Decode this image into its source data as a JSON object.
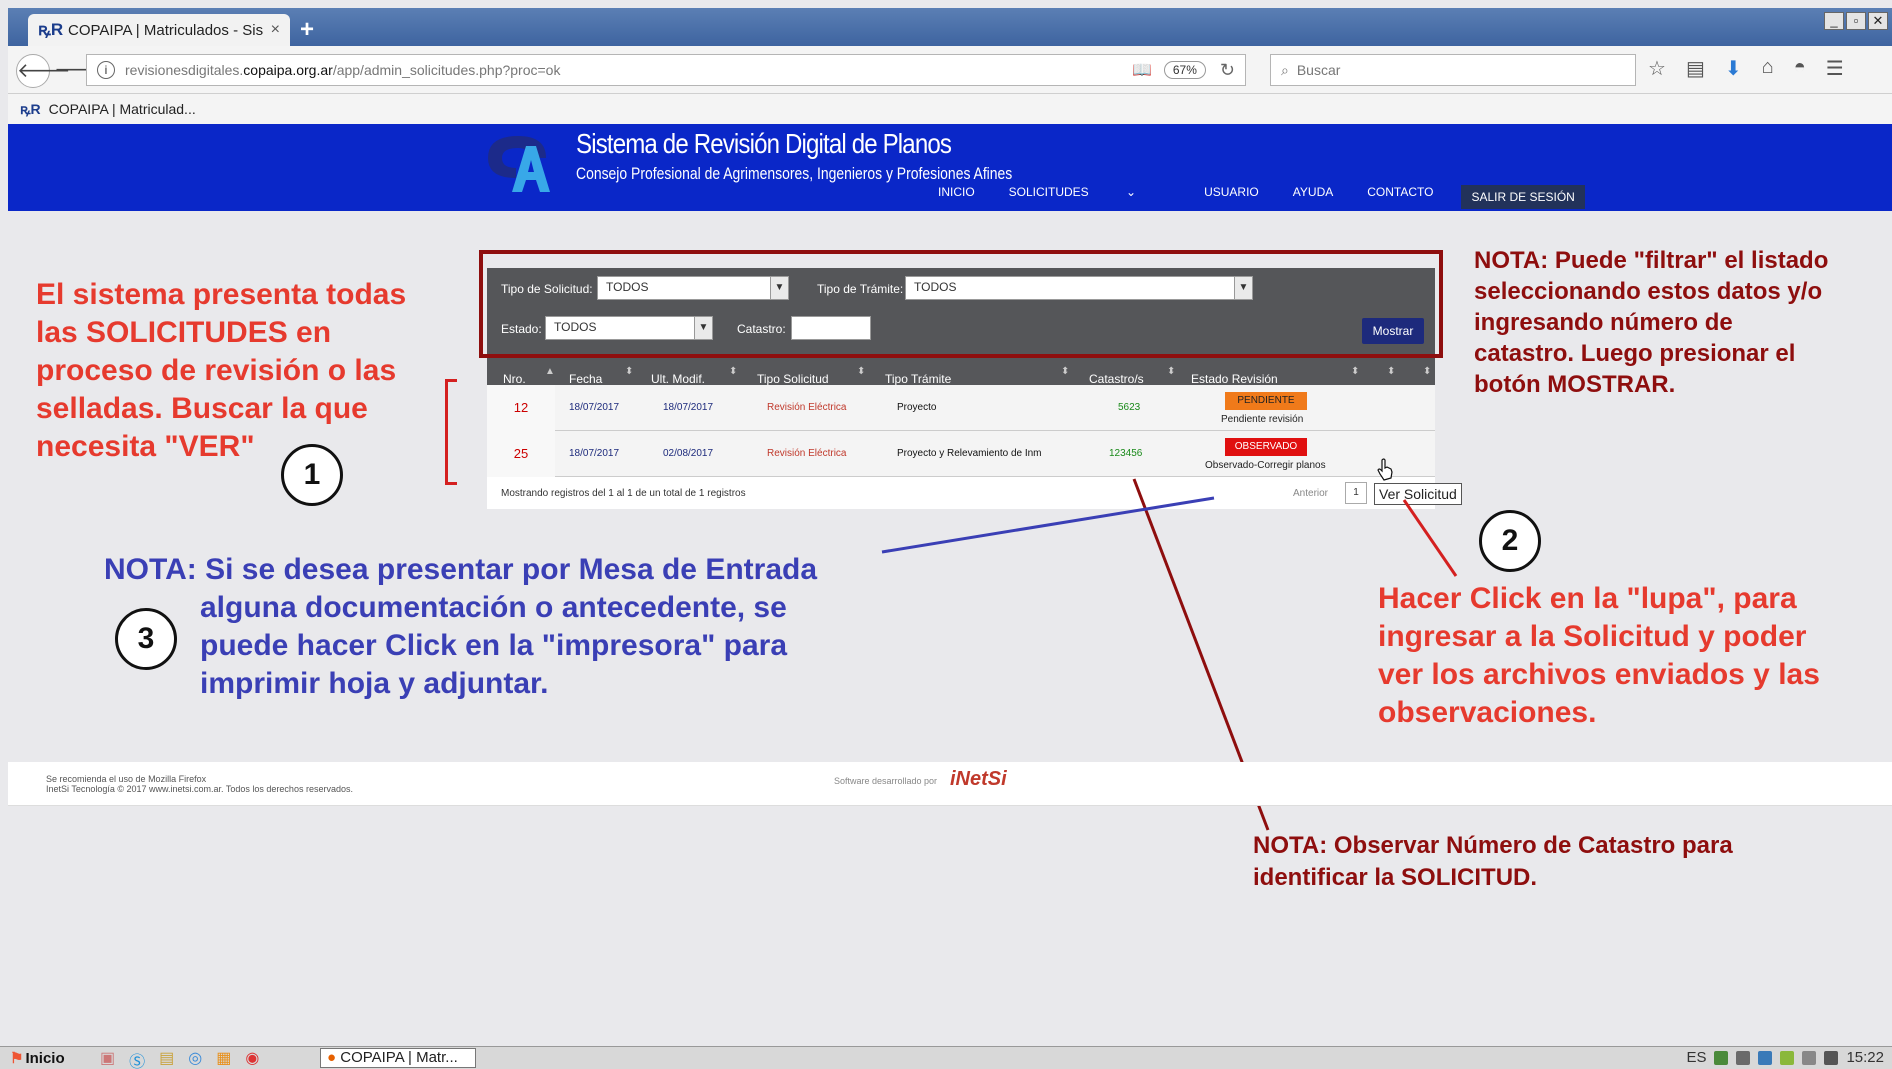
{
  "browser": {
    "tab_title": "COPAIPA | Matriculados - Sistem",
    "tab_close": "×",
    "new_tab": "+",
    "url_host_prefix": "revisionesdigitales.",
    "url_host": "copaipa.org.ar",
    "url_path": "/app/admin_solicitudes.php?proc=ok",
    "zoom": "67%",
    "search_placeholder": "Buscar",
    "bookmark": "COPAIPA | Matriculad..."
  },
  "header": {
    "title": "Sistema de Revisión Digital de Planos",
    "subtitle": "Consejo Profesional de Agrimensores, Ingenieros y Profesiones Afines",
    "menu": {
      "inicio": "INICIO",
      "solicitudes": "SOLICITUDES",
      "usuario": "USUARIO",
      "ayuda": "AYUDA",
      "contacto": "CONTACTO",
      "salir": "SALIR DE SESIÓN"
    }
  },
  "filters": {
    "tipo_solicitud_label": "Tipo de Solicitud:",
    "tipo_solicitud_value": "TODOS",
    "tipo_tramite_label": "Tipo de Trámite:",
    "tipo_tramite_value": "TODOS",
    "estado_label": "Estado:",
    "estado_value": "TODOS",
    "catastro_label": "Catastro:",
    "mostrar": "Mostrar"
  },
  "table": {
    "columns": {
      "nro": "Nro.",
      "fecha": "Fecha",
      "ult": "Ult. Modif.",
      "tsol": "Tipo Solicitud",
      "ttra": "Tipo Trámite",
      "cat": "Catastro/s",
      "estado": "Estado Revisión"
    },
    "rows": [
      {
        "nro": "12",
        "fecha": "18/07/2017",
        "modif": "18/07/2017",
        "tipo_solicitud": "Revisión Eléctrica",
        "tipo_tramite": "Proyecto",
        "catastro": "5623",
        "badge": "PENDIENTE",
        "estado": "Pendiente revisión"
      },
      {
        "nro": "25",
        "fecha": "18/07/2017",
        "modif": "02/08/2017",
        "tipo_solicitud": "Revisión Eléctrica",
        "tipo_tramite": "Proyecto y Relevamiento de Inm",
        "catastro": "123456",
        "badge": "OBSERVADO",
        "estado": "Observado-Corregir planos"
      }
    ],
    "footer_info": "Mostrando registros del 1 al 1 de un total de 1 registros",
    "prev": "Anterior",
    "page": "1",
    "tooltip": "Ver Solicitud"
  },
  "annotations": {
    "left": [
      "El sistema presenta todas",
      "las SOLICITUDES en",
      "proceso de revisión o las",
      "selladas. Buscar la que",
      "necesita \"VER\""
    ],
    "filter_note": [
      "NOTA: Puede \"filtrar\" el listado",
      "seleccionando estos datos y/o",
      "ingresando número de",
      "catastro. Luego presionar el",
      "botón MOSTRAR."
    ],
    "nota3_first": "NOTA: Si se desea presentar por Mesa de Entrada",
    "nota3_rest": [
      "alguna documentación o antecedente, se",
      "puede hacer Click en la \"impresora\" para",
      "imprimir hoja y adjuntar."
    ],
    "lupa_note": [
      "Hacer Click en la \"lupa\", para",
      "ingresar a la Solicitud y poder",
      "ver los archivos enviados y las",
      "observaciones."
    ],
    "catastro_note": [
      "NOTA: Observar Número de Catastro para",
      "identificar la SOLICITUD."
    ],
    "circle1": "1",
    "circle2": "2",
    "circle3": "3"
  },
  "site_footer": {
    "line1": "Se recomienda el uso de Mozilla Firefox",
    "line2": "InetSi Tecnología © 2017 www.inetsi.com.ar. Todos los derechos reservados.",
    "software_by": "Software desarrollado por",
    "brand": "iNetSi"
  },
  "taskbar": {
    "start": "Inicio",
    "app": "COPAIPA | Matr...",
    "lang": "ES",
    "clock": "15:22"
  },
  "colors": {
    "site_header": "#0a27c8",
    "annotation_red": "#e63a2e",
    "annotation_darkred": "#8e0e0e",
    "annotation_blue": "#3a3fb5",
    "badge_pending": "#f07a1a",
    "badge_observed": "#e01010"
  }
}
